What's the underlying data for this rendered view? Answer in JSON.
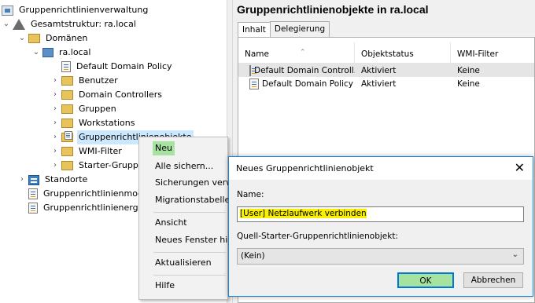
{
  "tree": {
    "items": [
      {
        "label": "Gruppenrichtlinienverwaltung",
        "arrow": "",
        "icon": "root-icon"
      },
      {
        "label": "Gesamtstruktur: ra.local",
        "arrow": "⌄",
        "icon": "forest-icon"
      },
      {
        "label": "Domänen",
        "arrow": "⌄",
        "icon": "folder-icon"
      },
      {
        "label": "ra.local",
        "arrow": "⌄",
        "icon": "domain-icon"
      },
      {
        "label": "Default Domain Policy",
        "arrow": "",
        "icon": "gpo-link-icon"
      },
      {
        "label": "Benutzer",
        "arrow": "›",
        "icon": "folder-icon"
      },
      {
        "label": "Domain Controllers",
        "arrow": "›",
        "icon": "folder-icon"
      },
      {
        "label": "Gruppen",
        "arrow": "›",
        "icon": "folder-icon"
      },
      {
        "label": "Workstations",
        "arrow": "›",
        "icon": "folder-icon"
      },
      {
        "label": "Gruppenrichtlinienobjekte",
        "arrow": "›",
        "icon": "gpo-folder-icon"
      },
      {
        "label": "WMI-Filter",
        "arrow": "›",
        "icon": "folder-icon"
      },
      {
        "label": "Starter-Gruppenrichtlinienobjekte",
        "arrow": "›",
        "icon": "folder-icon"
      },
      {
        "label": "Standorte",
        "arrow": "›",
        "icon": "sites-icon"
      },
      {
        "label": "Gruppenrichtlinienmodellierung",
        "arrow": "",
        "icon": "modeling-icon"
      },
      {
        "label": "Gruppenrichtlinienergebnisse",
        "arrow": "",
        "icon": "results-icon"
      }
    ]
  },
  "main": {
    "title": "Gruppenrichtlinienobjekte in ra.local",
    "tabs": [
      {
        "label": "Inhalt"
      },
      {
        "label": "Delegierung"
      }
    ],
    "columns": [
      "Name",
      "Objektstatus",
      "WMI-Filter"
    ],
    "rows": [
      {
        "name": "Default Domain Controllers Policy",
        "name_display": "Default Domain Controll...",
        "status": "Aktiviert",
        "wmi": "Keine"
      },
      {
        "name": "Default Domain Policy",
        "name_display": "Default Domain Policy",
        "status": "Aktiviert",
        "wmi": "Keine"
      }
    ]
  },
  "context_menu": {
    "items": [
      "Neu",
      "Alle sichern...",
      "Sicherungen verwalten...",
      "Migrationstabelle öffnen...",
      "Ansicht",
      "Neues Fenster hier öffnen",
      "Aktualisieren",
      "Hilfe"
    ],
    "visible_text": [
      "Neu",
      "Alle sichern...",
      "Sicherungen verw",
      "Migrationstabelle",
      "Ansicht",
      "Neues Fenster hie",
      "Aktualisieren",
      "Hilfe"
    ]
  },
  "dialog": {
    "title": "Neues Gruppenrichtlinienobjekt",
    "name_label": "Name:",
    "name_value": "[User] Netzlaufwerk verbinden",
    "starter_label": "Quell-Starter-Gruppenrichtlinienobjekt:",
    "starter_value": "(Kein)",
    "ok_label": "OK",
    "cancel_label": "Abbrechen",
    "close_glyph": "✕"
  },
  "colors": {
    "selection": "#cce8ff",
    "highlight_green": "#a6e3a0",
    "highlight_yellow": "#f8f000",
    "dialog_border": "#1883d7"
  }
}
